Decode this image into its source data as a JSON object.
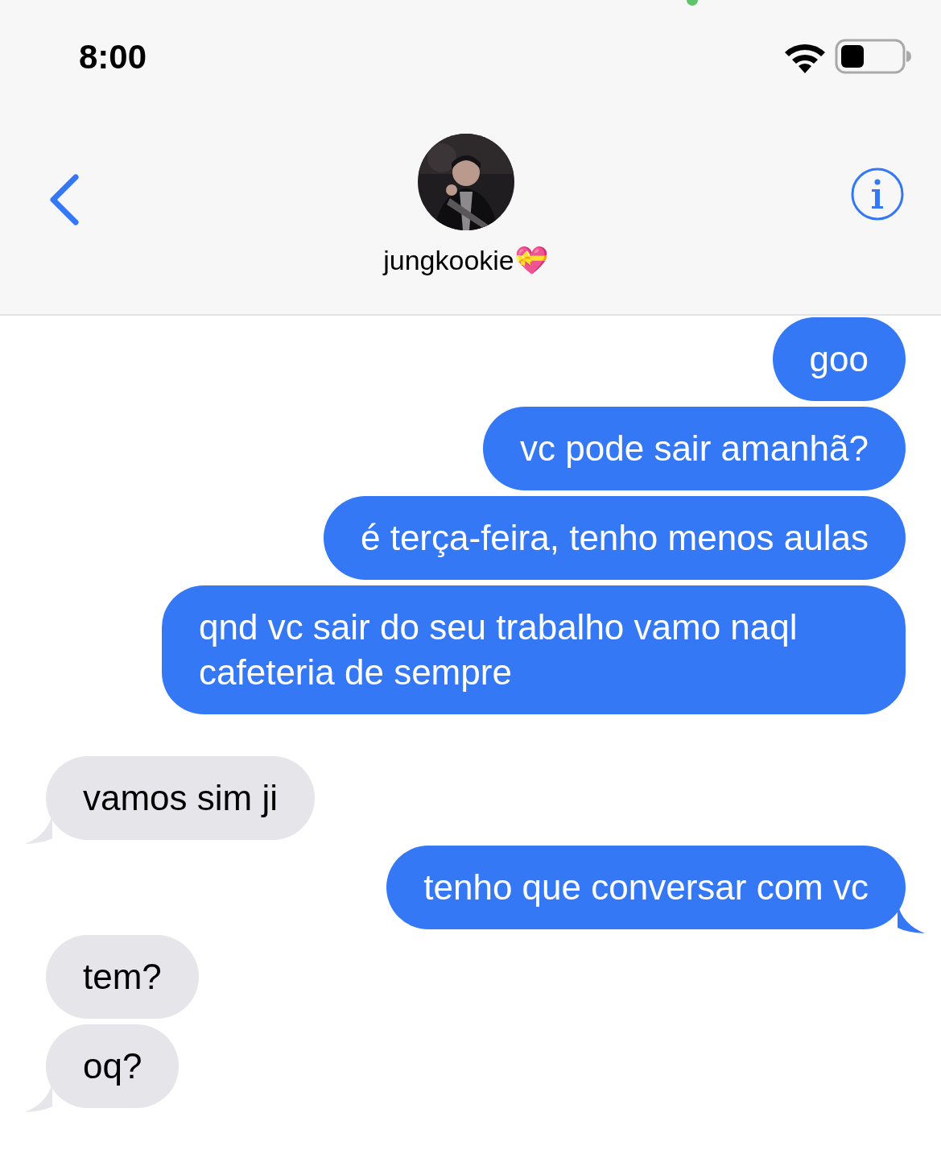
{
  "status_bar": {
    "time": "8:00"
  },
  "header": {
    "contact_name": "jungkookie💝"
  },
  "message_groups": [
    {
      "messages": [
        {
          "outgoing": true,
          "text": "goo",
          "tail": false
        },
        {
          "outgoing": true,
          "text": "vc pode sair amanhã?",
          "tail": false
        },
        {
          "outgoing": true,
          "text": "é terça-feira, tenho menos aulas",
          "tail": false
        },
        {
          "outgoing": true,
          "text": "qnd vc sair do seu trabalho vamo naql cafeteria de sempre",
          "tail": false
        }
      ]
    },
    {
      "messages": [
        {
          "outgoing": false,
          "text": "vamos sim ji",
          "tail": true
        },
        {
          "outgoing": true,
          "text": "tenho que conversar com vc",
          "tail": true
        },
        {
          "outgoing": false,
          "text": "tem?",
          "tail": false
        },
        {
          "outgoing": false,
          "text": "oq?",
          "tail": true
        }
      ]
    }
  ]
}
